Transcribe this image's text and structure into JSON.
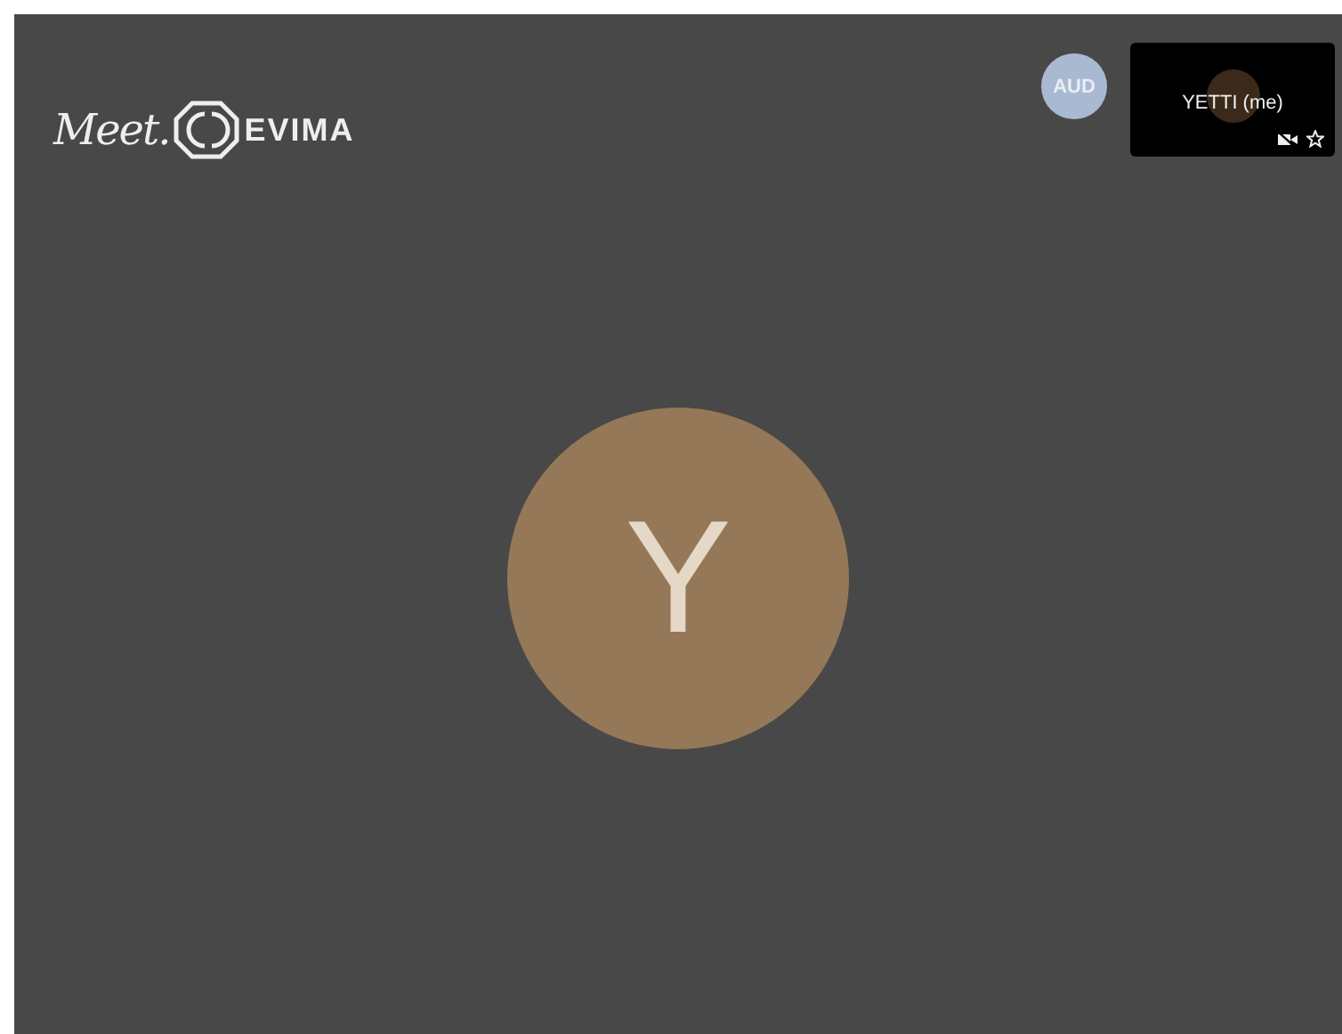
{
  "logo": {
    "script": "Meet.",
    "name": "EVIMA"
  },
  "audio_avatar": {
    "label": "AUD"
  },
  "self_tile": {
    "name": "YETTI (me)",
    "camera_off": true
  },
  "main_avatar": {
    "initial": "Y"
  }
}
